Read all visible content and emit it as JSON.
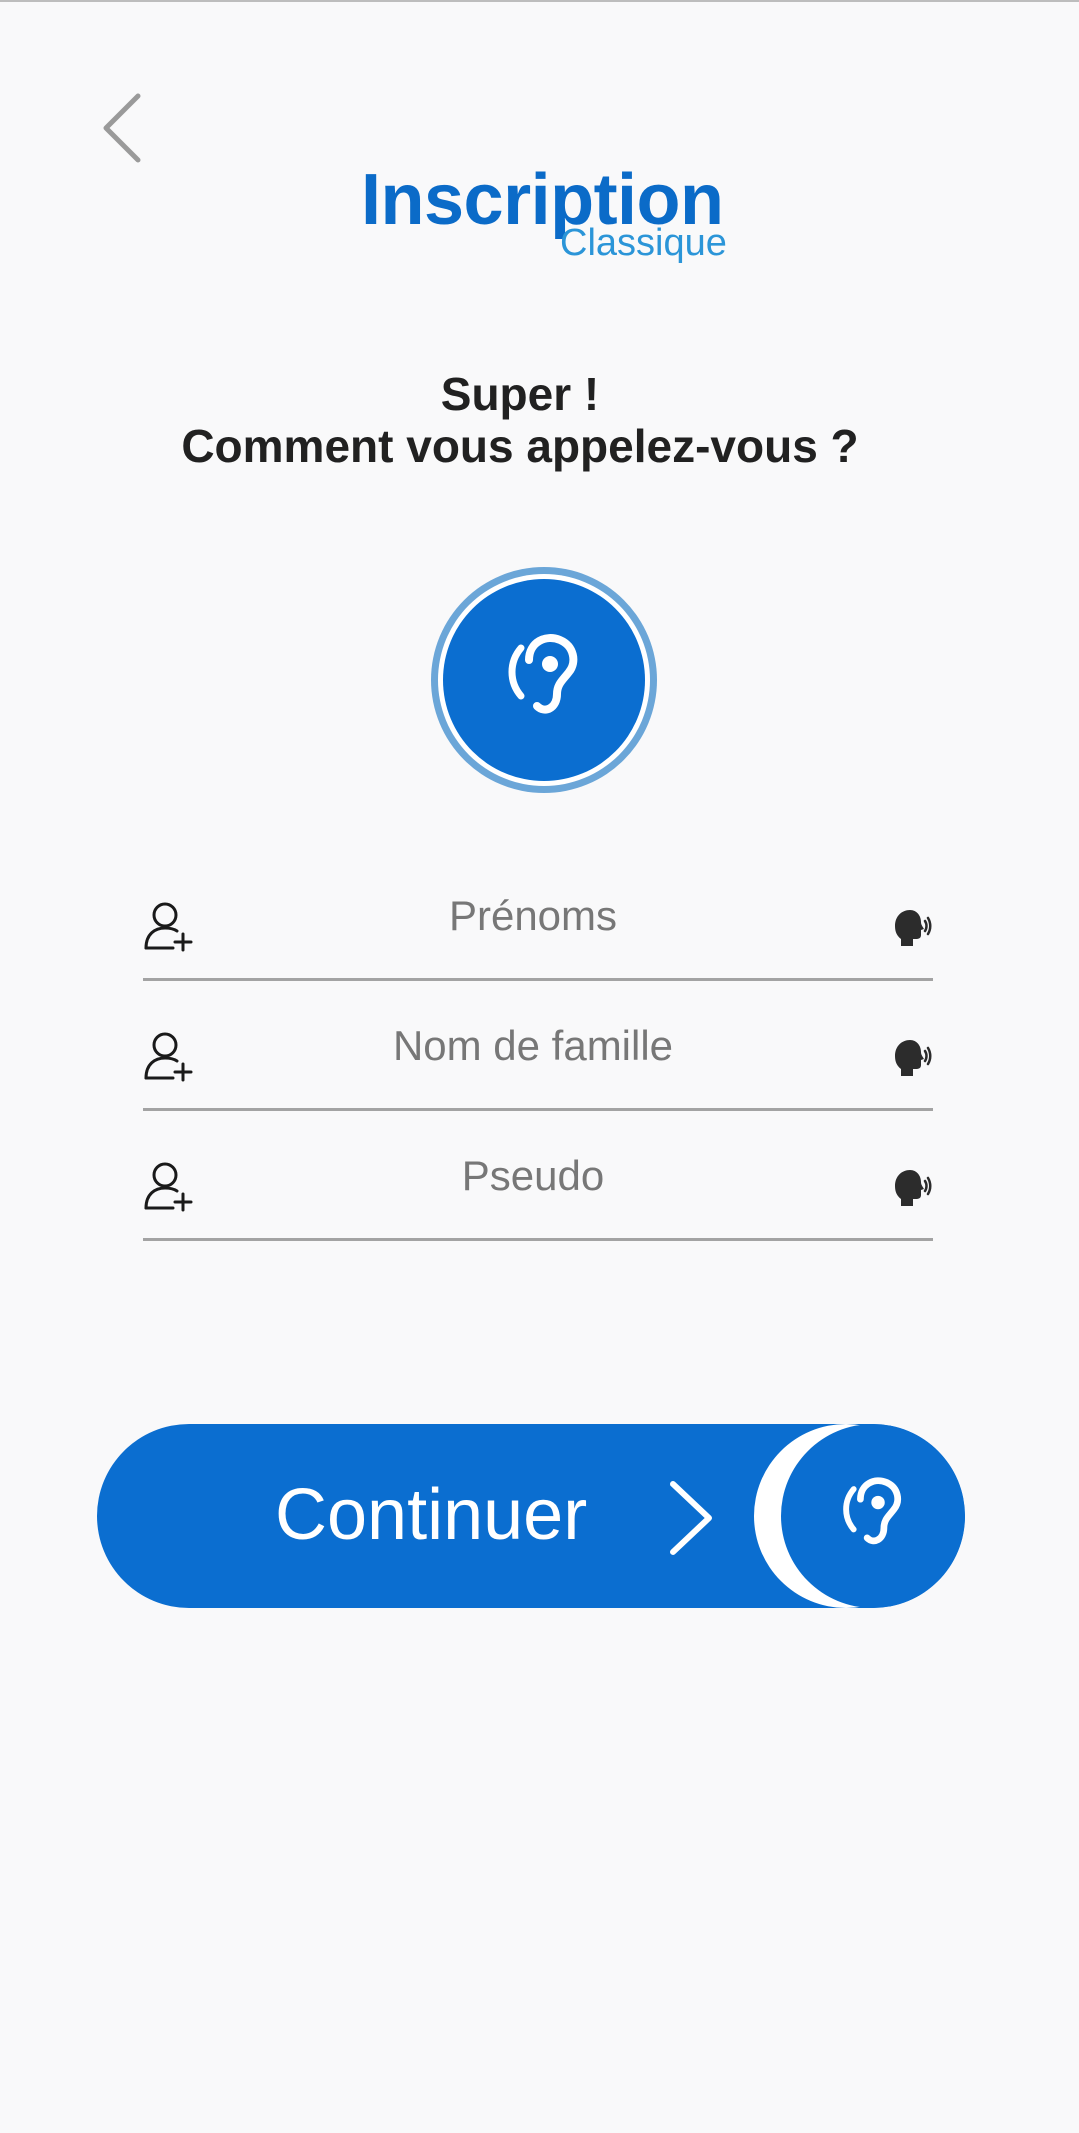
{
  "header": {
    "back_icon": "chevron-left-icon",
    "title": "Inscription",
    "subtitle": "Classique"
  },
  "question": {
    "line1": "Super !",
    "line2": "Comment vous appelez-vous ?"
  },
  "listen_button": {
    "icon": "ear-icon"
  },
  "form": {
    "fields": [
      {
        "placeholder": "Prénoms",
        "value": "",
        "icon": "add-user-icon",
        "voice_icon": "speaking-head-icon"
      },
      {
        "placeholder": "Nom de famille",
        "value": "",
        "icon": "add-user-icon",
        "voice_icon": "speaking-head-icon"
      },
      {
        "placeholder": "Pseudo",
        "value": "",
        "icon": "add-user-icon",
        "voice_icon": "speaking-head-icon"
      }
    ]
  },
  "continue_button": {
    "label": "Continuer",
    "arrow_icon": "chevron-right-icon",
    "knob_icon": "ear-icon"
  },
  "colors": {
    "primary": "#0b6ed0",
    "title_blue": "#0b6bc8",
    "subtitle_blue": "#2b95d8",
    "ring_light_blue": "#6ba6d8",
    "background": "#f9f9fa",
    "text_dark": "#212121",
    "placeholder_gray": "#777777",
    "underline_gray": "#a3a3a3"
  }
}
